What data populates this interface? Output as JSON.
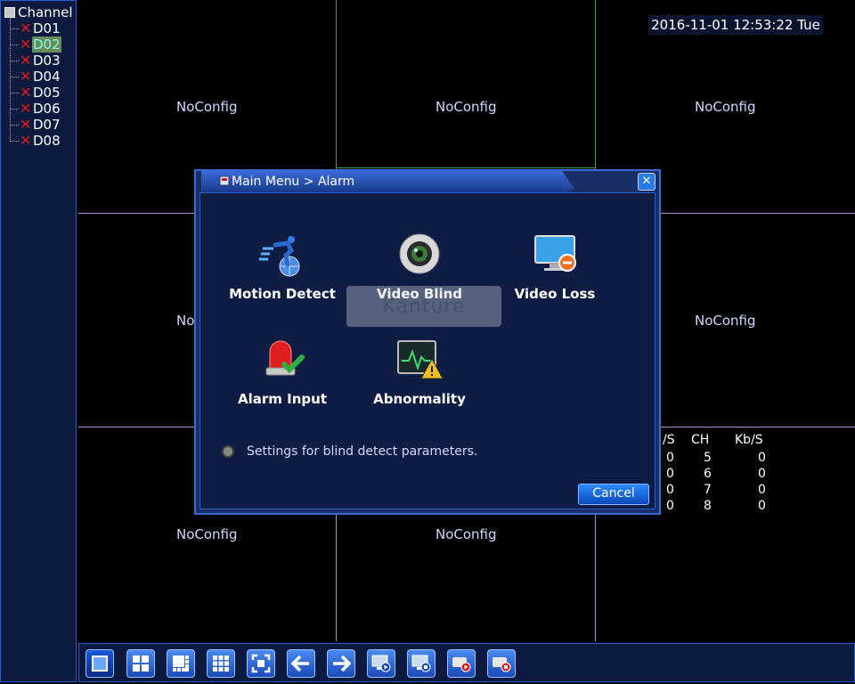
{
  "sidebar": {
    "root_label": "Channel",
    "channels": [
      {
        "label": "D01"
      },
      {
        "label": "D02"
      },
      {
        "label": "D03"
      },
      {
        "label": "D04"
      },
      {
        "label": "D05"
      },
      {
        "label": "D06"
      },
      {
        "label": "D07"
      },
      {
        "label": "D08"
      }
    ],
    "selected": "D02"
  },
  "grid": {
    "cell_text": "NoConfig",
    "cell_text_partial": "No",
    "datetime": "2016-11-01 12:53:22 Tue",
    "stats": {
      "headers": [
        "/S",
        "CH",
        "Kb/S"
      ],
      "rows": [
        [
          "0",
          "5",
          "0"
        ],
        [
          "0",
          "6",
          "0"
        ],
        [
          "0",
          "7",
          "0"
        ],
        [
          "0",
          "8",
          "0"
        ]
      ]
    }
  },
  "dialog": {
    "title": "Main Menu > Alarm",
    "close_label": "✕",
    "items": [
      {
        "label": "Motion Detect",
        "icon": "motion-detect-icon"
      },
      {
        "label": "Video Blind",
        "icon": "video-blind-icon"
      },
      {
        "label": "Video Loss",
        "icon": "video-loss-icon"
      },
      {
        "label": "Alarm Input",
        "icon": "alarm-input-icon"
      },
      {
        "label": "Abnormality",
        "icon": "abnormality-icon"
      }
    ],
    "hint": "Settings for blind detect parameters.",
    "cancel_label": "Cancel",
    "watermark": "Kanture"
  },
  "toolbar": {
    "buttons": [
      "single-view",
      "quad-view",
      "eight-view",
      "nine-view",
      "fullscreen",
      "previous",
      "next",
      "playback",
      "record-stop",
      "record-start",
      "stop-record"
    ]
  },
  "colors": {
    "accent": "#2a5bd0",
    "grid_line": "#b090c8",
    "active_line": "#2fa84a",
    "error_mark": "#e01818"
  }
}
